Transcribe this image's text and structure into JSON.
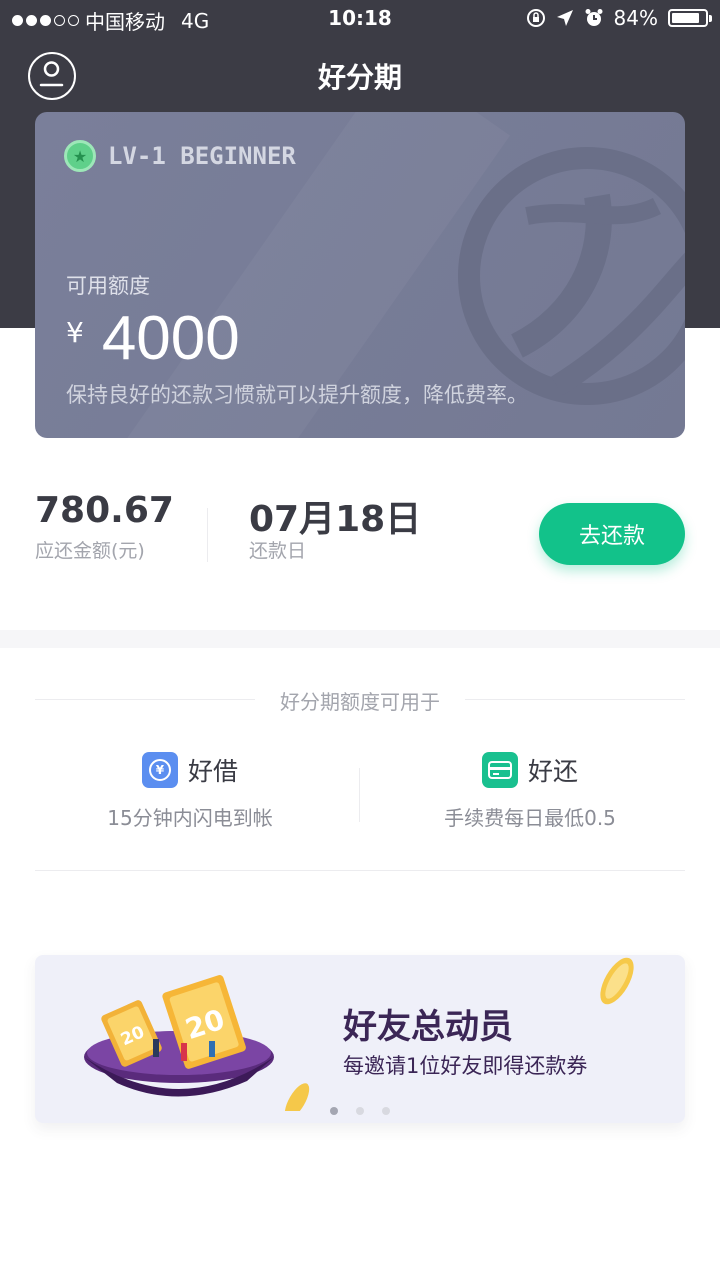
{
  "status_bar": {
    "carrier": "中国移动",
    "network": "4G",
    "time": "10:18",
    "battery": "84%",
    "battery_level": 0.84
  },
  "nav": {
    "title": "好分期",
    "avatar_icon": "user-profile-icon"
  },
  "card": {
    "level": "LV-1 BEGINNER",
    "level_icon": "star-badge-icon",
    "available_label": "可用额度",
    "currency": "¥",
    "amount": "4000",
    "hint": "保持良好的还款习惯就可以提升额度，降低费率。"
  },
  "repay": {
    "due_amount": "780.67",
    "due_amount_label": "应还金额(元)",
    "due_date": "07月18日",
    "due_date_label": "还款日",
    "button_label": "去还款"
  },
  "usage": {
    "title": "好分期额度可用于",
    "items": [
      {
        "name": "好借",
        "desc": "15分钟内闪电到帐",
        "icon": "yen-icon",
        "glyph": "¥",
        "color": "#5b8ef0"
      },
      {
        "name": "好还",
        "desc": "手续费每日最低0.5",
        "icon": "card-icon",
        "color": "#19c08f"
      }
    ]
  },
  "banner": {
    "title": "好友总动员",
    "subtitle": "每邀请1位好友即得还款券",
    "coupon_value": "20",
    "page_count": 3,
    "active_page": 1
  },
  "colors": {
    "header_bg": "#3c3c45",
    "card_bg": "#777c96",
    "accent_green": "#12c28a",
    "banner_title": "#3b2656"
  }
}
